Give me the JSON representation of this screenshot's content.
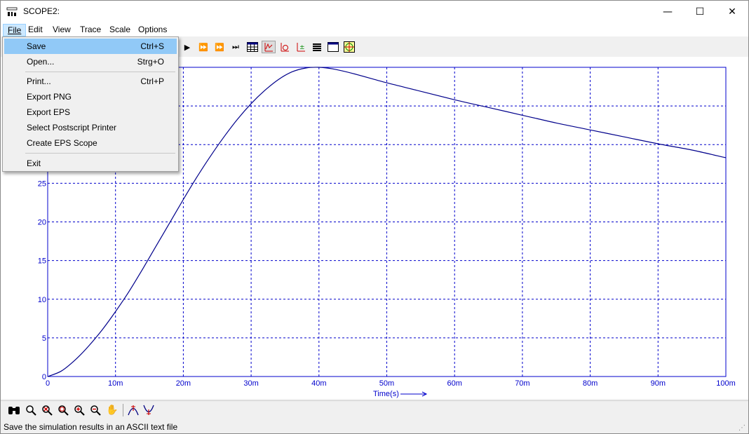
{
  "window": {
    "title": "SCOPE2:",
    "icon": "scope-app-icon",
    "minimize": "—",
    "maximize": "☐",
    "close": "✕"
  },
  "menubar": [
    {
      "label": "File",
      "active": true
    },
    {
      "label": "Edit"
    },
    {
      "label": "View"
    },
    {
      "label": "Trace"
    },
    {
      "label": "Scale"
    },
    {
      "label": "Options"
    }
  ],
  "file_menu": {
    "items": [
      {
        "label": "Save",
        "shortcut": "Ctrl+S"
      },
      {
        "label": "Open...",
        "shortcut": "Strg+O"
      },
      {
        "label": "Print...",
        "shortcut": "Ctrl+P"
      },
      {
        "label": "Export PNG",
        "shortcut": ""
      },
      {
        "label": "Export EPS",
        "shortcut": ""
      },
      {
        "label": "Select Postscript Printer",
        "shortcut": ""
      },
      {
        "label": "Create EPS Scope",
        "shortcut": ""
      },
      {
        "label": "Exit",
        "shortcut": ""
      }
    ]
  },
  "toolbar": {
    "icons": [
      "play-icon",
      "fast-forward-icon",
      "faster-forward-icon",
      "skip-end-icon",
      "table-icon",
      "trace-icon",
      "circle-trace-icon",
      "marker-icon",
      "list-icon",
      "window-icon",
      "crosshair-icon"
    ]
  },
  "bottom_toolbar": {
    "icons": [
      "binoculars-icon",
      "zoom-icon",
      "zoom-reset-icon",
      "zoom-area-icon",
      "zoom-in-icon",
      "zoom-out-icon",
      "pan-hand-icon",
      "cursor-max-icon",
      "cursor-min-icon"
    ]
  },
  "status": {
    "text": "Save the simulation results in an ASCII text file"
  },
  "colors": {
    "trace": "#00008b",
    "grid": "#0000cc",
    "axis_text": "#0000cc"
  },
  "chart_data": {
    "type": "line",
    "xlabel": "Time(s)",
    "x_tick_labels": [
      "0",
      "10m",
      "20m",
      "30m",
      "40m",
      "50m",
      "60m",
      "70m",
      "80m",
      "90m",
      "100m"
    ],
    "y_tick_labels": [
      "0",
      "5",
      "10",
      "15",
      "20",
      "25"
    ],
    "xlim": [
      0,
      0.1
    ],
    "ylim": [
      0,
      40
    ],
    "grid": true,
    "series": [
      {
        "x": [
          0,
          0.002,
          0.004,
          0.006,
          0.008,
          0.01,
          0.012,
          0.014,
          0.016,
          0.018,
          0.02,
          0.022,
          0.024,
          0.026,
          0.028,
          0.03,
          0.032,
          0.034,
          0.036,
          0.038,
          0.04,
          0.042,
          0.045,
          0.05,
          0.055,
          0.06,
          0.065,
          0.07,
          0.075,
          0.08,
          0.085,
          0.09,
          0.095,
          0.1
        ],
        "y": [
          0,
          0.7,
          2.1,
          3.9,
          6.0,
          8.4,
          11.0,
          13.9,
          16.9,
          19.9,
          22.9,
          25.8,
          28.5,
          31.0,
          33.3,
          35.3,
          37.0,
          38.4,
          39.4,
          39.9,
          40.0,
          39.8,
          39.2,
          38.0,
          36.9,
          35.8,
          34.8,
          33.8,
          32.8,
          31.9,
          31.0,
          30.1,
          29.3,
          28.3
        ]
      }
    ]
  }
}
